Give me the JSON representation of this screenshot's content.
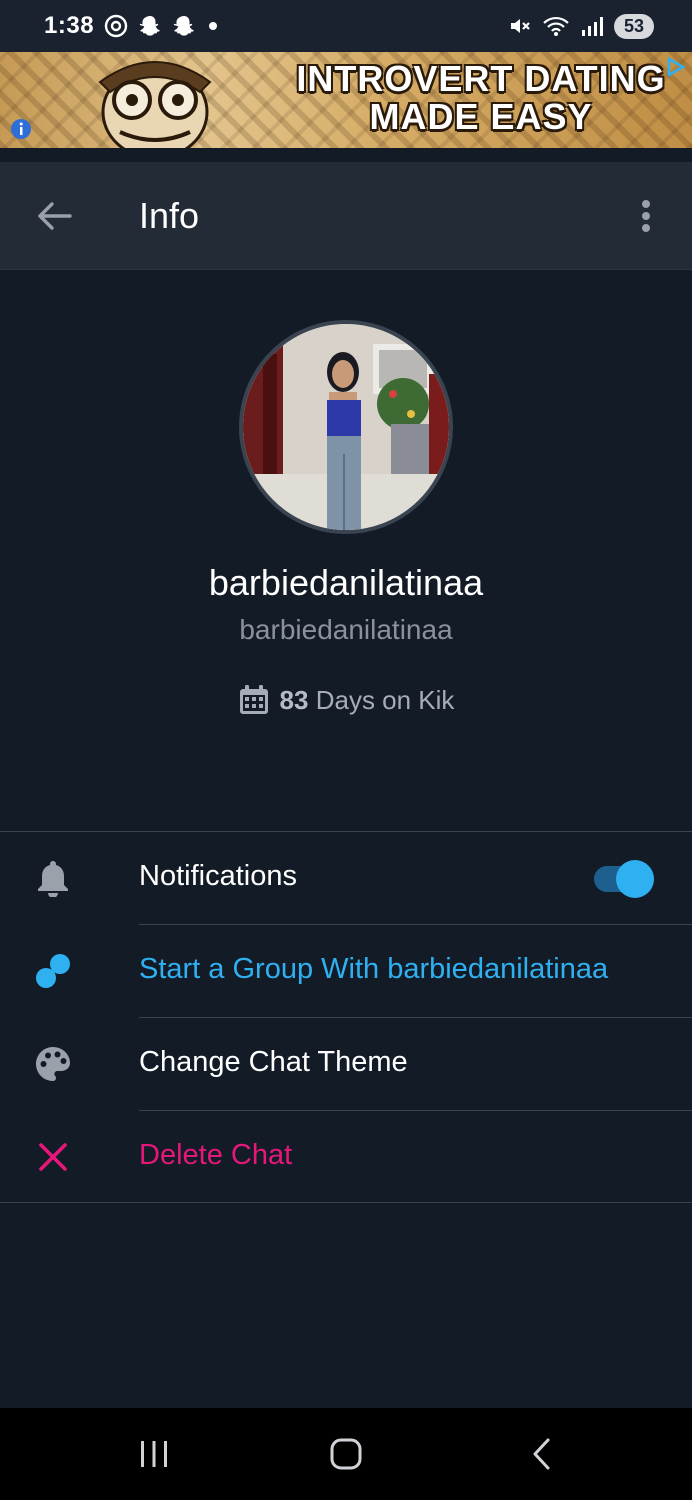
{
  "status_bar": {
    "time": "1:38",
    "battery": "53"
  },
  "ad": {
    "headline_line1": "INTROVERT DATING",
    "headline_line2": "MADE EASY"
  },
  "app_bar": {
    "title": "Info"
  },
  "profile": {
    "display_name": "barbiedanilatinaa",
    "username": "barbiedanilatinaa",
    "days_count": "83",
    "days_suffix": "Days on Kik"
  },
  "menu": {
    "notifications": {
      "label": "Notifications",
      "enabled": true
    },
    "start_group": {
      "label": "Start a Group With barbiedanilatinaa"
    },
    "change_theme": {
      "label": "Change Chat Theme"
    },
    "delete_chat": {
      "label": "Delete Chat"
    }
  },
  "colors": {
    "background": "#131b27",
    "app_bar": "#222b36",
    "accent_blue": "#2fb0f0",
    "danger_pink": "#e5177a",
    "muted_text": "#8b929c"
  },
  "icons": {
    "back": "arrow-left-icon",
    "more": "more-vertical-icon",
    "calendar": "calendar-icon",
    "notifications": "bell-icon",
    "group": "group-bubbles-icon",
    "theme": "palette-icon",
    "delete": "close-icon"
  }
}
